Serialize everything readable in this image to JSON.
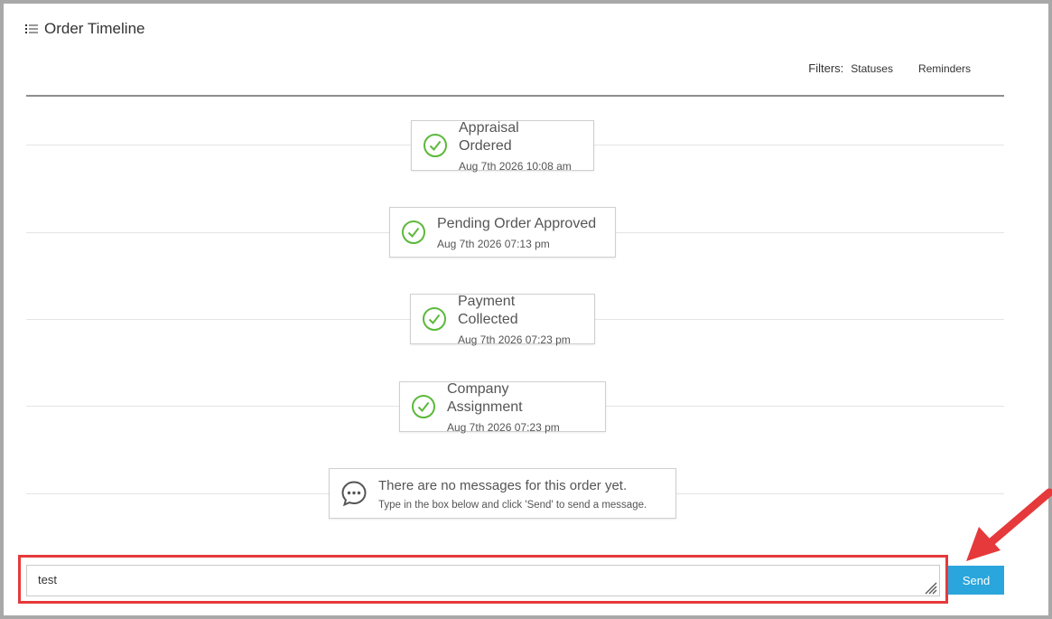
{
  "header": {
    "title": "Order Timeline",
    "icon": "list-icon"
  },
  "filters": {
    "label": "Filters:",
    "options": [
      "Statuses",
      "Reminders"
    ]
  },
  "timeline": [
    {
      "title": "Appraisal Ordered",
      "date": "Aug 7th 2026 10:08 am",
      "icon": "check-circle-icon"
    },
    {
      "title": "Pending Order Approved",
      "date": "Aug 7th 2026 07:13 pm",
      "icon": "check-circle-icon"
    },
    {
      "title": "Payment Collected",
      "date": "Aug 7th 2026 07:23 pm",
      "icon": "check-circle-icon"
    },
    {
      "title": "Company Assignment",
      "date": "Aug 7th 2026 07:23 pm",
      "icon": "check-circle-icon"
    }
  ],
  "messages": {
    "empty_title": "There are no messages for this order yet.",
    "empty_hint": "Type in the box below and click 'Send' to send a message.",
    "icon": "chat-bubble-icon"
  },
  "composer": {
    "value": "test",
    "send_label": "Send"
  },
  "colors": {
    "check_green": "#5cb93b",
    "send_blue": "#2aa6dc",
    "annotation_red": "#e5393b"
  }
}
